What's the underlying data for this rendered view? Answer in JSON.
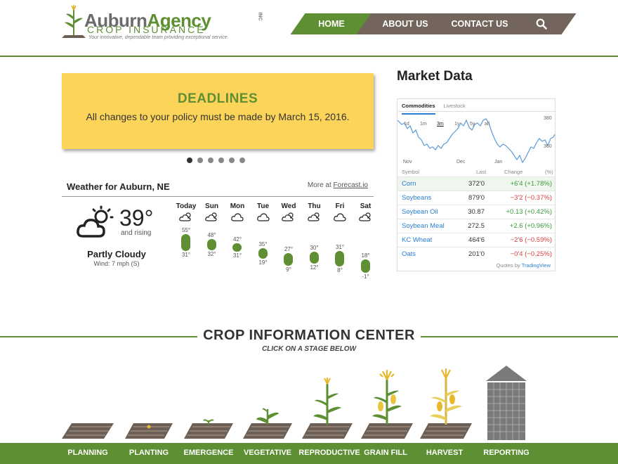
{
  "logo": {
    "name_part1": "Auburn",
    "name_part2": "Agency",
    "inc": "INC",
    "subtitle": "CROP INSURANCE",
    "tagline": "Your innovative, dependable team providing exceptional service."
  },
  "nav": {
    "home": "HOME",
    "about": "ABOUT US",
    "contact": "CONTACT US",
    "search_icon": "search-icon"
  },
  "colors": {
    "brand_green": "#5e8f32",
    "nav_brown": "#73655b",
    "banner_yellow": "#fcd45a",
    "link_blue": "#2a7fd4"
  },
  "banner": {
    "title": "DEADLINES",
    "text": "All changes to your policy must be made by March 15, 2016.",
    "slide_count": 6,
    "active_slide": 1
  },
  "weather": {
    "title": "Weather for Auburn, NE",
    "more_prefix": "More at ",
    "more_link": "Forecast.io",
    "current": {
      "temp": "39°",
      "trend": "and rising",
      "summary": "Partly Cloudy",
      "wind": "Wind: 7 mph (S)",
      "icon": "partly-cloudy-icon"
    },
    "days": [
      {
        "name": "Today",
        "hi": "55°",
        "lo": "31°",
        "icon": "partly-cloudy-icon"
      },
      {
        "name": "Sun",
        "hi": "48°",
        "lo": "32°",
        "icon": "partly-cloudy-icon"
      },
      {
        "name": "Mon",
        "hi": "42°",
        "lo": "31°",
        "icon": "cloudy-icon"
      },
      {
        "name": "Tue",
        "hi": "35°",
        "lo": "19°",
        "icon": "cloudy-icon"
      },
      {
        "name": "Wed",
        "hi": "27°",
        "lo": "9°",
        "icon": "partly-cloudy-icon"
      },
      {
        "name": "Thu",
        "hi": "30°",
        "lo": "12°",
        "icon": "partly-cloudy-icon"
      },
      {
        "name": "Fri",
        "hi": "31°",
        "lo": "8°",
        "icon": "cloudy-icon"
      },
      {
        "name": "Sat",
        "hi": "18°",
        "lo": "-1°",
        "icon": "partly-cloudy-icon"
      }
    ]
  },
  "market": {
    "title": "Market Data",
    "tabs": [
      "Commodities",
      "Livestock"
    ],
    "ranges": [
      "1d",
      "1m",
      "3m",
      "1y",
      "5y",
      "all"
    ],
    "active_range": "3m",
    "y_ticks": [
      "380",
      "360"
    ],
    "x_ticks": [
      "Nov",
      "Dec",
      "Jan"
    ],
    "headers": {
      "symbol": "Symbol",
      "last": "Last",
      "change": "Change",
      "pct": "(%)"
    },
    "rows": [
      {
        "symbol": "Corn",
        "last": "372'0",
        "change": "+6'4 (+1.78%)",
        "dir": "up"
      },
      {
        "symbol": "Soybeans",
        "last": "879'0",
        "change": "−3'2 (−0.37%)",
        "dir": "down"
      },
      {
        "symbol": "Soybean Oil",
        "last": "30.87",
        "change": "+0.13 (+0.42%)",
        "dir": "up"
      },
      {
        "symbol": "Soybean Meal",
        "last": "272.5",
        "change": "+2.6 (+0.96%)",
        "dir": "up"
      },
      {
        "symbol": "KC Wheat",
        "last": "464'6",
        "change": "−2'6 (−0.59%)",
        "dir": "down"
      },
      {
        "symbol": "Oats",
        "last": "201'0",
        "change": "−0'4 (−0.25%)",
        "dir": "down"
      }
    ],
    "footer_prefix": "Quotes by ",
    "footer_link": "TradingView"
  },
  "crop": {
    "title": "CROP INFORMATION CENTER",
    "subtitle": "CLICK ON A STAGE BELOW",
    "stages": [
      "PLANNING",
      "PLANTING",
      "EMERGENCE",
      "VEGETATIVE",
      "REPRODUCTIVE",
      "GRAIN FILL",
      "HARVEST",
      "REPORTING"
    ]
  }
}
